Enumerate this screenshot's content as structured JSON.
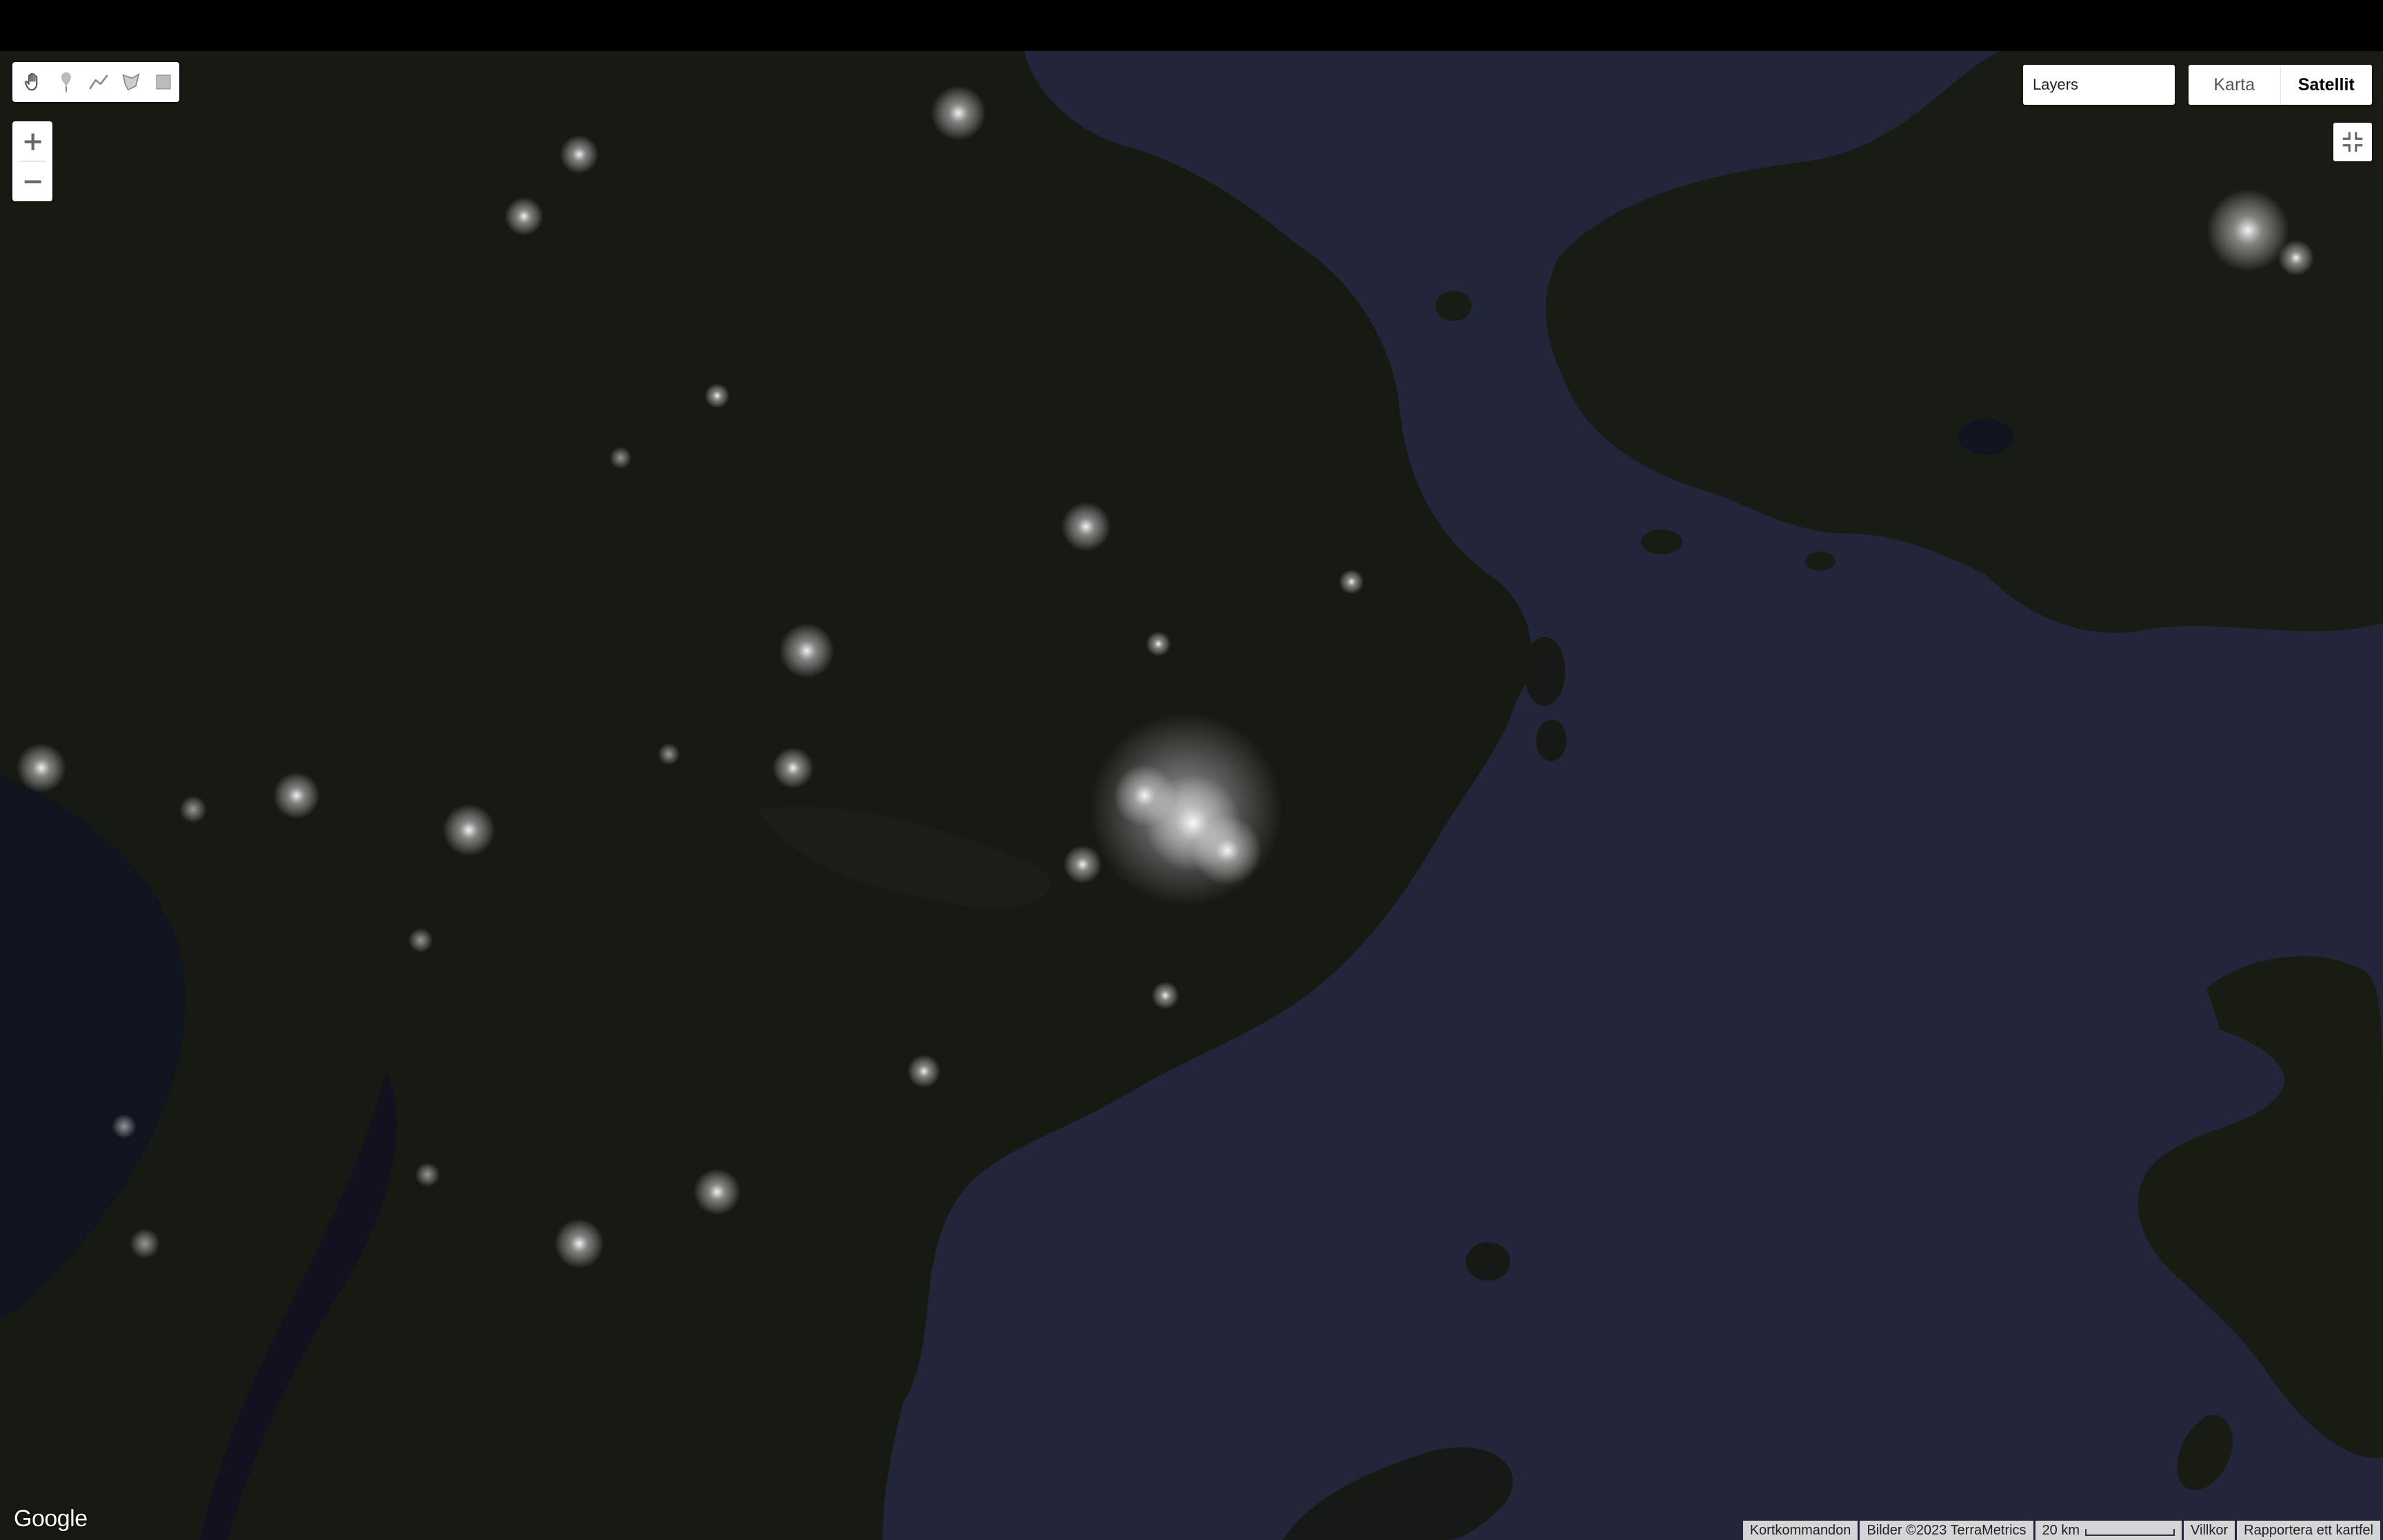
{
  "map": {
    "provider_logo": "Google",
    "layers_label": "Layers",
    "map_types": [
      {
        "label": "Karta",
        "selected": false
      },
      {
        "label": "Satellit",
        "selected": true
      }
    ],
    "colors": {
      "sea": "#23263a",
      "land": "#171a14",
      "city_lights": "#ffffff"
    }
  },
  "drawing_tools": [
    {
      "icon": "hand-icon"
    },
    {
      "icon": "marker-icon"
    },
    {
      "icon": "polyline-icon"
    },
    {
      "icon": "polygon-icon"
    },
    {
      "icon": "rectangle-icon"
    }
  ],
  "zoom": {
    "in_label": "+",
    "out_label": "−"
  },
  "attribution": {
    "shortcuts": "Kortkommandon",
    "imagery": "Bilder ©2023 TerraMetrics",
    "scale": "20 km",
    "terms": "Villkor",
    "report": "Rapportera ett kartfel"
  }
}
